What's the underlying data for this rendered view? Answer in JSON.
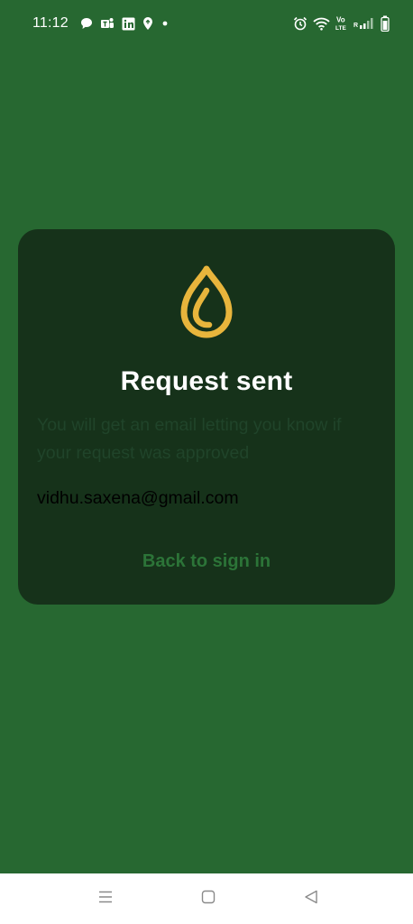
{
  "status_bar": {
    "time": "11:12",
    "notification_icons": [
      "chat-bubble-icon",
      "teams-icon",
      "linkedin-icon",
      "location-pin-icon",
      "dot-icon"
    ],
    "system_icons": [
      "alarm-icon",
      "wifi-icon",
      "volte-icon",
      "signal-icon",
      "battery-icon"
    ],
    "volte_top": "Vo",
    "volte_bottom": "LTE",
    "signal_r": "R"
  },
  "dialog": {
    "logo": "drop-logo-icon",
    "title": "Request sent",
    "subtitle": "You will get an email letting you know if your request was approved",
    "email": "vidhu.saxena@gmail.com",
    "back_link": "Back to sign in"
  },
  "colors": {
    "background": "#276831",
    "dialog": "#16321a",
    "logo": "#e8b53c",
    "link": "#2c7438"
  },
  "nav_bar": {
    "buttons": [
      "menu-icon",
      "home-icon",
      "back-icon"
    ]
  }
}
